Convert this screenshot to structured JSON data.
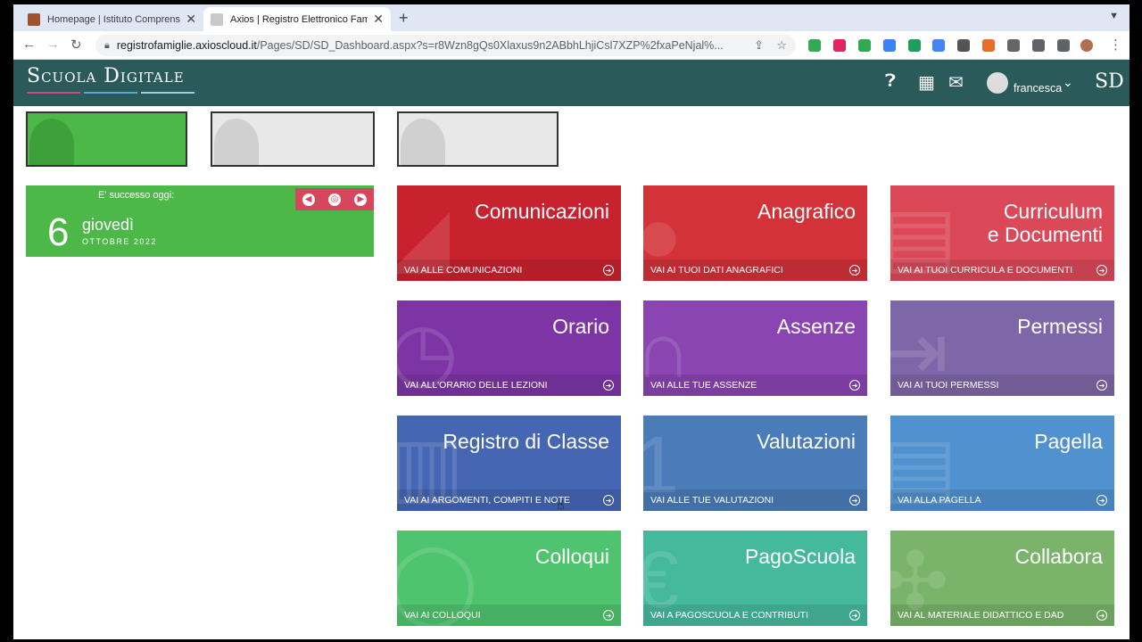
{
  "browser": {
    "tabs": [
      {
        "title": "Homepage | Istituto Comprensivo",
        "active": false
      },
      {
        "title": "Axios | Registro Elettronico Famiglie",
        "active": true
      }
    ],
    "url_domain": "registrofamiglie.axioscloud.it",
    "url_path": "/Pages/SD/SD_Dashboard.aspx?s=r8Wzn8gQs0Xlaxus9n2ABbhLhjiCsl7XZP%2fxaPeNjal%..."
  },
  "header": {
    "logo": "Scuola Digitale",
    "username": "francesca",
    "sd_logo": "SD",
    "colors": {
      "bar": "#2a5a5a"
    }
  },
  "date_widget": {
    "label": "E' successo oggi:",
    "day": "6",
    "weekday": "giovedì",
    "month_year": "OTTOBRE 2022"
  },
  "tiles": [
    {
      "title": "Comunicazioni",
      "footer": "VAI ALLE COMUNICAZIONI",
      "color": "#c8222e",
      "icon": "megaphone-icon"
    },
    {
      "title": "Anagrafico",
      "footer": "VAI AI TUOI DATI ANAGRAFICI",
      "color": "#d23238",
      "icon": "person-icon"
    },
    {
      "title": "Curriculum\ne Documenti",
      "footer": "VAI AI TUOI CURRICULA E DOCUMENTI",
      "color": "#db4959",
      "icon": "document-icon"
    },
    {
      "title": "Orario",
      "footer": "VAI ALL'ORARIO DELLE LEZIONI",
      "color": "#7d35a6",
      "icon": "clock-icon"
    },
    {
      "title": "Assenze",
      "footer": "VAI ALLE TUE ASSENZE",
      "color": "#8a45b2",
      "icon": "stethoscope-icon"
    },
    {
      "title": "Permessi",
      "footer": "VAI AI TUOI PERMESSI",
      "color": "#7e67a8",
      "icon": "exit-icon"
    },
    {
      "title": "Registro di Classe",
      "footer": "VAI AI ARGOMENTI, COMPITI E NOTE",
      "color": "#4466b3",
      "icon": "book-icon"
    },
    {
      "title": "Valutazioni",
      "footer": "VAI ALLE TUE VALUTAZIONI",
      "color": "#4b7cba",
      "icon": "numbers-icon"
    },
    {
      "title": "Pagella",
      "footer": "VAI ALLA PAGELLA",
      "color": "#5091d0",
      "icon": "report-icon"
    },
    {
      "title": "Colloqui",
      "footer": "VAI AI COLLOQUI",
      "color": "#4ec46f",
      "icon": "chat-icon"
    },
    {
      "title": "PagoScuola",
      "footer": "VAI A PAGOSCUOLA E CONTRIBUTI",
      "color": "#44b99c",
      "icon": "euro-icon"
    },
    {
      "title": "Collabora",
      "footer": "VAI AL MATERIALE DIDATTICO E DAD",
      "color": "#7ab46a",
      "icon": "puzzle-icon"
    }
  ]
}
